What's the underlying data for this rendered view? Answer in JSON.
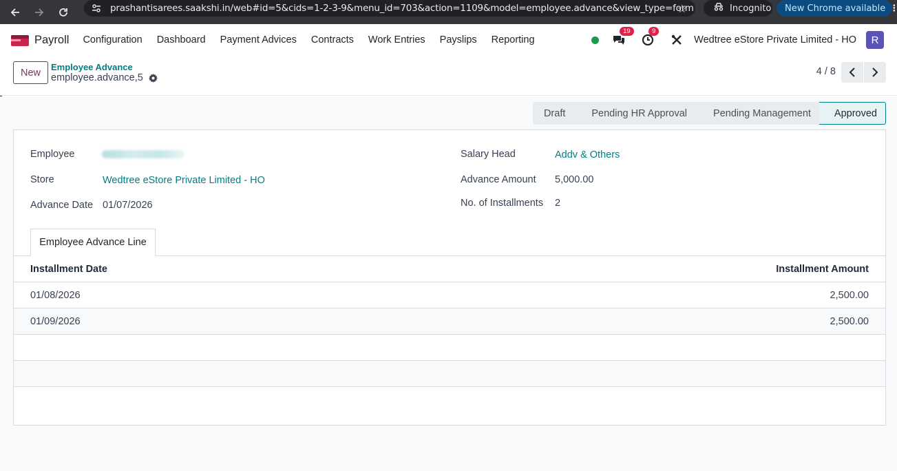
{
  "browser": {
    "url": "prashantisarees.saakshi.in/web#id=5&cids=1-2-3-9&menu_id=703&action=1109&model=employee.advance&view_type=form",
    "incognito_label": "Incognito",
    "update_label": "New Chrome available"
  },
  "navbar": {
    "brand": "Payroll",
    "menu": [
      "Configuration",
      "Dashboard",
      "Payment Advices",
      "Contracts",
      "Work Entries",
      "Payslips",
      "Reporting"
    ],
    "messages_badge": "19",
    "activities_badge": "9",
    "company": "Wedtree eStore Private Limited - HO",
    "avatar_letter": "R"
  },
  "control_panel": {
    "new_label": "New",
    "breadcrumb_parent": "Employee Advance",
    "breadcrumb_current": "employee.advance,5",
    "pager": "4 / 8"
  },
  "status": {
    "stages": [
      "Draft",
      "Pending HR Approval",
      "Pending Management",
      "Approved"
    ],
    "active": "Approved"
  },
  "form": {
    "employee_label": "Employee",
    "store_label": "Store",
    "store_value": "Wedtree eStore Private Limited - HO",
    "advance_date_label": "Advance Date",
    "advance_date_value": "01/07/2026",
    "salary_head_label": "Salary Head",
    "salary_head_value": "Addv & Others",
    "advance_amount_label": "Advance Amount",
    "advance_amount_value": "5,000.00",
    "installments_label": "No. of Installments",
    "installments_value": "2"
  },
  "tab": {
    "label": "Employee Advance Line"
  },
  "table": {
    "headers": [
      "Installment Date",
      "Installment Amount"
    ],
    "rows": [
      {
        "date": "01/08/2026",
        "amount": "2,500.00"
      },
      {
        "date": "01/09/2026",
        "amount": "2,500.00"
      }
    ]
  },
  "colors": {
    "accent_teal": "#017e84",
    "brand_purple": "#71395c",
    "badge_red": "#e0204a",
    "online_green": "#1a9c4a"
  }
}
